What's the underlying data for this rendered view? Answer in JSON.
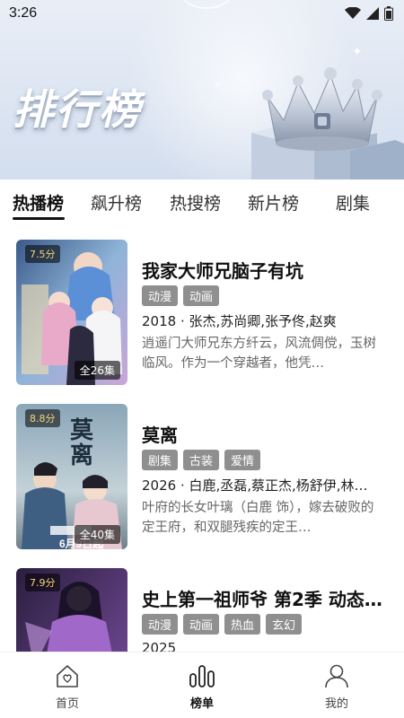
{
  "status": {
    "time": "3:26"
  },
  "banner": {
    "title": "排行榜"
  },
  "tabs": [
    {
      "label": "热播榜"
    },
    {
      "label": "飙升榜"
    },
    {
      "label": "热搜榜"
    },
    {
      "label": "新片榜"
    },
    {
      "label": "剧集"
    }
  ],
  "items": [
    {
      "title": "我家大师兄脑子有坑",
      "score": "7.5分",
      "episodes": "全26集",
      "tags": [
        "动漫",
        "动画"
      ],
      "meta": "2018 · 张杰,苏尚卿,张予佟,赵爽",
      "desc": "逍遥门大师兄东方纤云，风流倜傥，玉树临风。作为一个穿越者，他凭…",
      "poster_colors": [
        "#3a5a8a",
        "#c9a6d8"
      ]
    },
    {
      "title": "莫离",
      "score": "8.8分",
      "episodes": "全40集",
      "tags": [
        "剧集",
        "古装",
        "爱情"
      ],
      "meta": "2026 · 白鹿,丞磊,蔡正杰,杨舒伊,林…",
      "desc": "叶府的长女叶璃（白鹿 饰），嫁去破败的定王府，和双腿残疾的定王…",
      "poster_colors": [
        "#6e8fa6",
        "#d9c7b8"
      ]
    },
    {
      "title": "史上第一祖师爷 第2季 动态…",
      "score": "7.9分",
      "episodes": "",
      "tags": [
        "动漫",
        "动画",
        "热血",
        "玄幻"
      ],
      "meta": "2025",
      "desc": "",
      "poster_colors": [
        "#2a1e3e",
        "#7a4fa0"
      ]
    }
  ],
  "nav": [
    {
      "label": "首页",
      "icon": "home-icon"
    },
    {
      "label": "榜单",
      "icon": "ranking-icon"
    },
    {
      "label": "我的",
      "icon": "profile-icon"
    }
  ],
  "colors": {
    "accent": "#111111",
    "tag_bg": "#8f8f8f",
    "score": "#f7d674"
  }
}
